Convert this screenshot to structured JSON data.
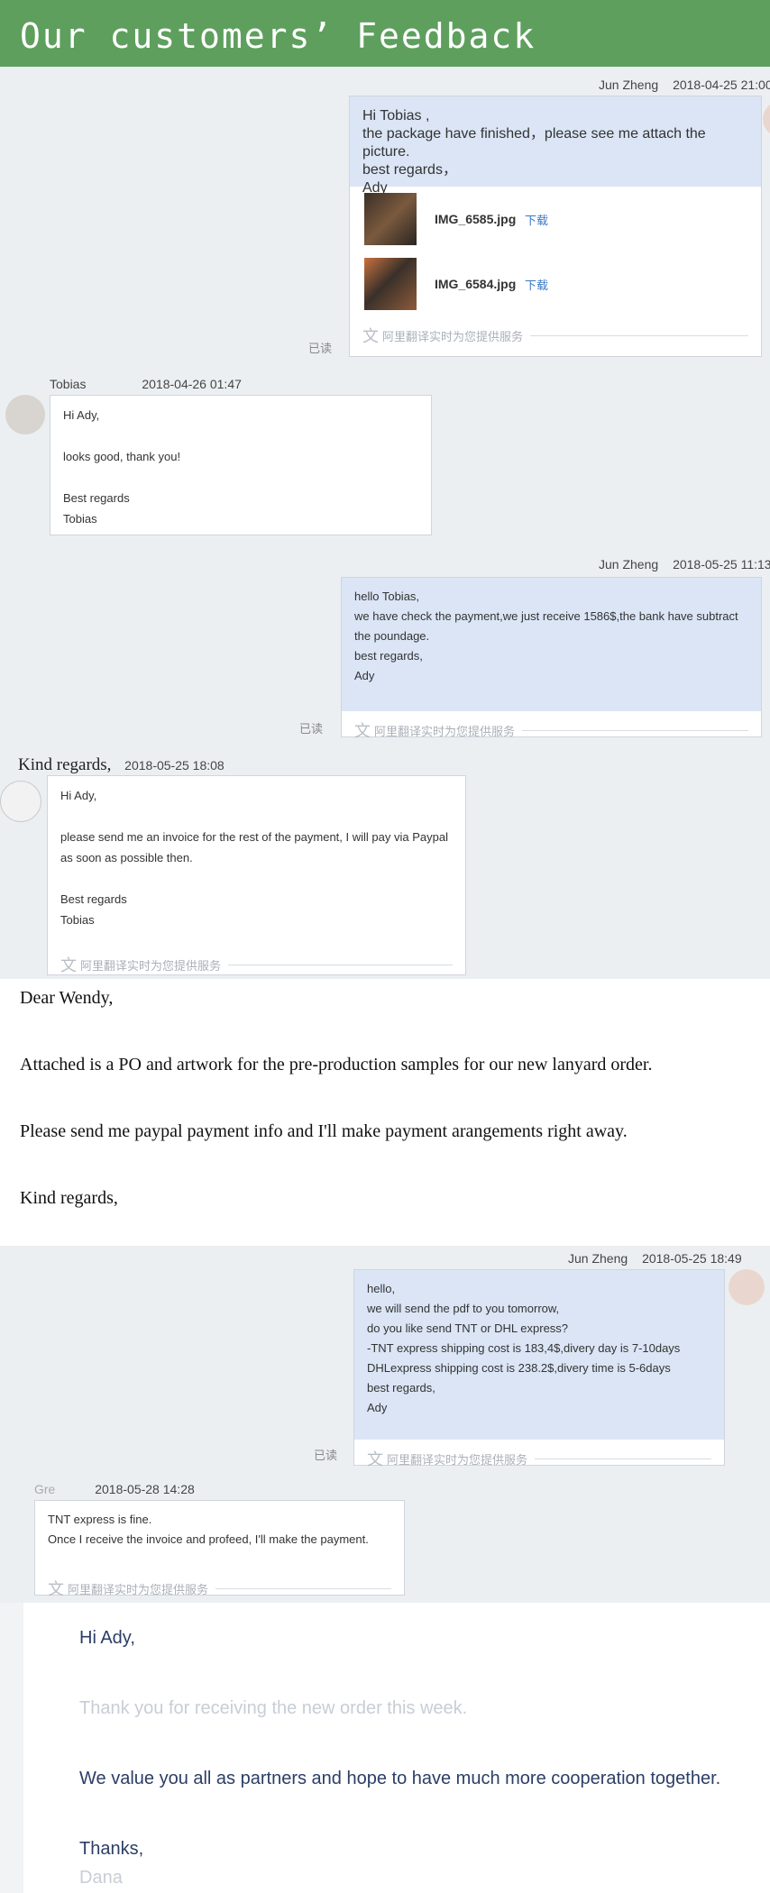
{
  "header": {
    "title": "Our customers’ Feedback"
  },
  "messages": [
    {
      "sender": "Jun Zheng",
      "time": "2018-04-25 21:00",
      "read": "已读",
      "text": "Hi Tobias ,\nthe package have finished，please see me attach the picture.\nbest regards，\nAdy",
      "attachments": [
        {
          "name": "IMG_6585.jpg",
          "download": "下载"
        },
        {
          "name": "IMG_6584.jpg",
          "download": "下载"
        }
      ],
      "translate": "阿里翻译实时为您提供服务"
    },
    {
      "sender": "Tobias",
      "time": "2018-04-26 01:47",
      "text": "Hi Ady,\n\nlooks good, thank you!\n\nBest regards\nTobias"
    },
    {
      "sender": "Jun Zheng",
      "time": "2018-05-25 11:13",
      "read": "已读",
      "text": "hello Tobias,\nwe have check the payment,we just receive 1586$,the bank have subtract the poundage.\nbest regards,\nAdy",
      "translate": "阿里翻译实时为您提供服务"
    },
    {
      "sender": "Kind regards,",
      "time": "2018-05-25 18:08",
      "text": "Hi Ady,\n\nplease send me an invoice for the rest of the payment, I will pay via Paypal as soon as possible then.\n\nBest regards\nTobias",
      "translate": "阿里翻译实时为您提供服务"
    },
    {
      "sender": "Jun Zheng",
      "time": "2018-05-25 18:49",
      "read": "已读",
      "text": "hello,\nwe will send the pdf to you tomorrow,\ndo you like send TNT or DHL express?\n-TNT express shipping cost is 183,4$,divery day is 7-10days\nDHLexpress shipping cost is 238.2$,divery time is 5-6days\nbest regards,\nAdy",
      "translate": "阿里翻译实时为您提供服务"
    },
    {
      "sender": "Gre",
      "time": "2018-05-28 14:28",
      "text": "TNT express is fine.\nOnce I receive the invoice and profeed, I'll make the payment.",
      "translate": "阿里翻译实时为您提供服务"
    }
  ],
  "email1": {
    "greeting": "Dear Wendy,",
    "line1": "Attached is a PO and artwork for the pre-production samples for our new lanyard order.",
    "line2": "Please send me paypal payment info and I'll make payment arangements right away.",
    "closing": "Kind regards,"
  },
  "email2": {
    "greeting": "Hi Ady,",
    "line1": "Thank you for receiving the new order this week.",
    "line2": "We value you all as partners and hope to have much more cooperation together.",
    "closing": "Thanks,",
    "signature": "Dana"
  }
}
